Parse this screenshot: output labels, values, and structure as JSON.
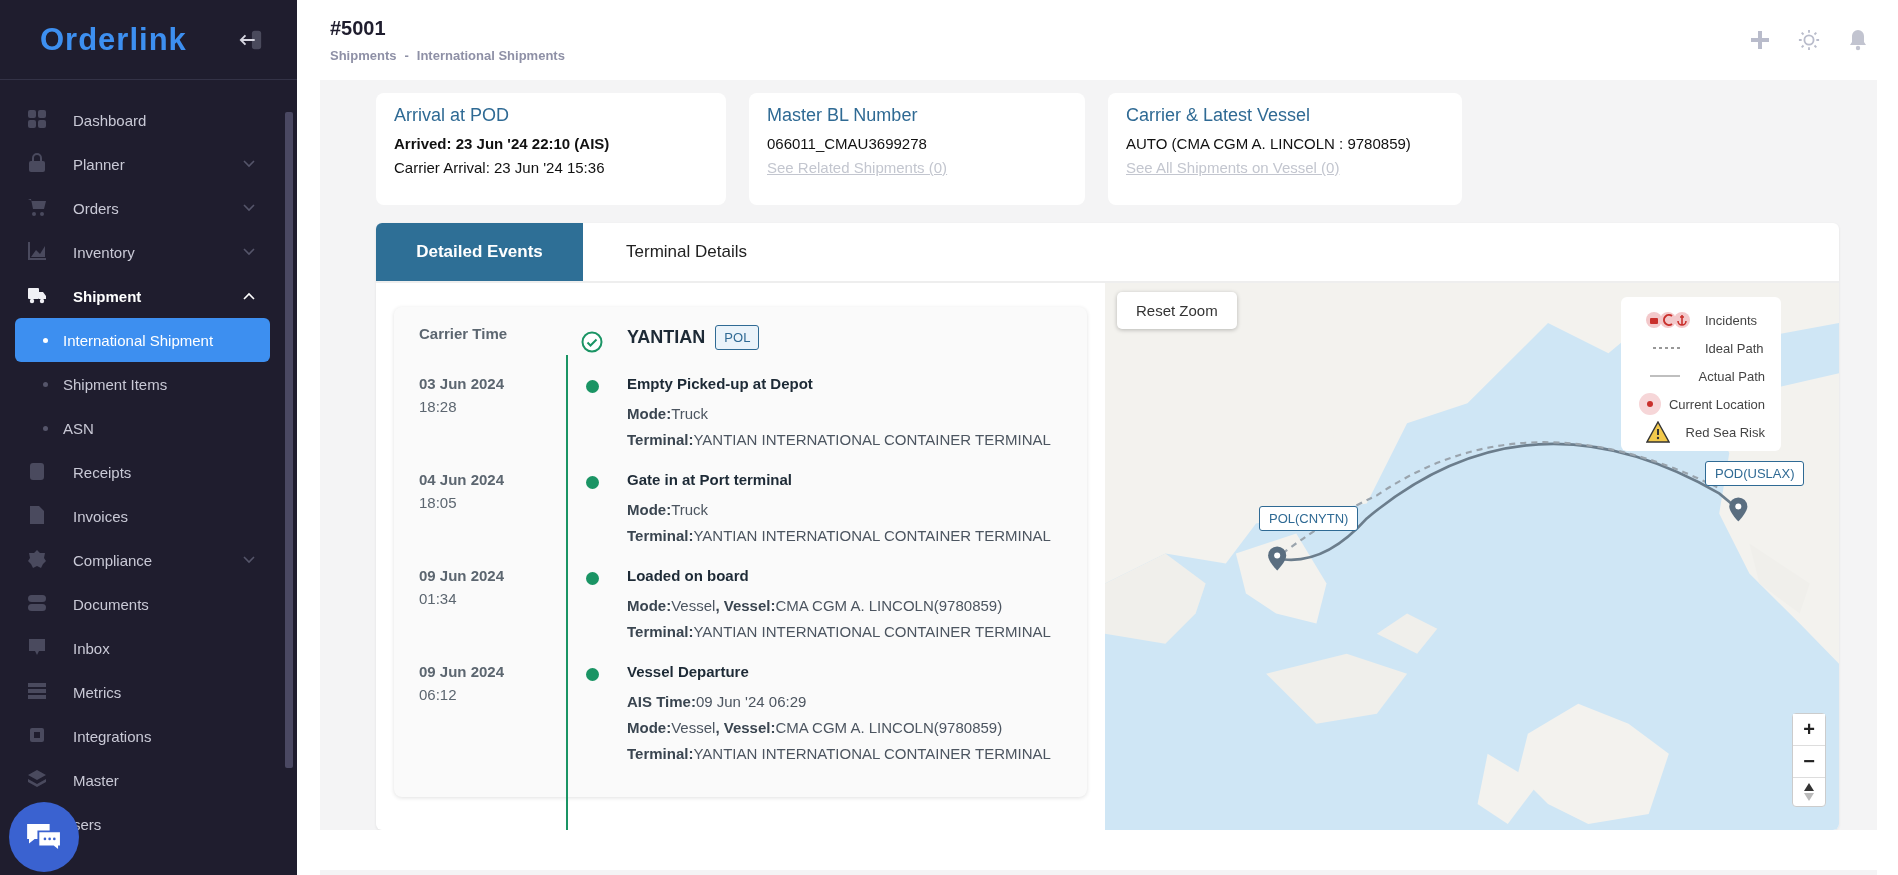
{
  "sidebar": {
    "logo": "Orderlink",
    "items": [
      {
        "label": "Dashboard",
        "kind": "grid"
      },
      {
        "label": "Planner",
        "kind": "bag",
        "expanded": false
      },
      {
        "label": "Orders",
        "kind": "cart",
        "expanded": false
      },
      {
        "label": "Inventory",
        "kind": "chart",
        "expanded": false
      },
      {
        "label": "Shipment",
        "kind": "truck",
        "expanded": true,
        "children": [
          {
            "label": "International Shipment",
            "selected": true
          },
          {
            "label": "Shipment Items",
            "selected": false
          },
          {
            "label": "ASN",
            "selected": false
          }
        ]
      },
      {
        "label": "Receipts",
        "kind": "receipt"
      },
      {
        "label": "Invoices",
        "kind": "doc"
      },
      {
        "label": "Compliance",
        "kind": "badge",
        "expanded": false
      },
      {
        "label": "Documents",
        "kind": "toggle"
      },
      {
        "label": "Inbox",
        "kind": "chat"
      },
      {
        "label": "Metrics",
        "kind": "list"
      },
      {
        "label": "Integrations",
        "kind": "chip"
      },
      {
        "label": "Master",
        "kind": "layers"
      },
      {
        "label": "sers",
        "kind": "none"
      }
    ]
  },
  "header": {
    "title": "#5001",
    "breadcrumb": [
      "Shipments",
      "-",
      "International Shipments"
    ]
  },
  "summary_cards": [
    {
      "title": "Arrival at POD",
      "lines": [
        {
          "text": "Arrived: 23 Jun '24 22:10 (AIS)",
          "kind": "strong"
        },
        {
          "text": "Carrier Arrival: 23 Jun '24 15:36",
          "kind": "plain"
        }
      ]
    },
    {
      "title": "Master BL Number",
      "lines": [
        {
          "text": "066011_CMAU3699278",
          "kind": "plain"
        },
        {
          "text": "See Related Shipments (0)",
          "kind": "link"
        }
      ]
    },
    {
      "title": "Carrier & Latest Vessel",
      "lines": [
        {
          "text": "AUTO (CMA CGM A. LINCOLN : 9780859)",
          "kind": "plain"
        },
        {
          "text": "See All Shipments on Vessel (0)",
          "kind": "link"
        }
      ]
    }
  ],
  "tabs": [
    {
      "label": "Detailed Events",
      "selected": true
    },
    {
      "label": "Terminal Details",
      "selected": false
    }
  ],
  "timeline": {
    "time_heading": "Carrier Time",
    "port": "YANTIAN",
    "port_badge": "POL",
    "events": [
      {
        "date": "03 Jun 2024",
        "time": "18:28",
        "title": "Empty Picked-up at Depot",
        "details": [
          "**Mode:**Truck",
          "**Terminal:**YANTIAN INTERNATIONAL CONTAINER TERMINAL"
        ]
      },
      {
        "date": "04 Jun 2024",
        "time": "18:05",
        "title": "Gate in at Port terminal",
        "details": [
          "**Mode:**Truck",
          "**Terminal:**YANTIAN INTERNATIONAL CONTAINER TERMINAL"
        ]
      },
      {
        "date": "09 Jun 2024",
        "time": "01:34",
        "title": "Loaded on board",
        "details": [
          "**Mode:**Vessel**, Vessel:**CMA CGM A. LINCOLN(9780859)",
          "**Terminal:**YANTIAN INTERNATIONAL CONTAINER TERMINAL"
        ]
      },
      {
        "date": "09 Jun 2024",
        "time": "06:12",
        "title": "Vessel Departure",
        "details": [
          "**AIS Time:**09 Jun '24 06:29",
          "**Mode:**Vessel**, Vessel:**CMA CGM A. LINCOLN(9780859)",
          "**Terminal:**YANTIAN INTERNATIONAL CONTAINER TERMINAL"
        ]
      }
    ]
  },
  "map": {
    "reset_button": "Reset Zoom",
    "pol_label": "POL(CNYTN)",
    "pod_label": "POD(USLAX)",
    "legend": [
      {
        "label": "Incidents",
        "kind": "incidents"
      },
      {
        "label": "Ideal Path",
        "kind": "dashed"
      },
      {
        "label": "Actual Path",
        "kind": "solid"
      },
      {
        "label": "Current Location",
        "kind": "location"
      },
      {
        "label": "Red Sea Risk",
        "kind": "warning"
      }
    ],
    "zoom_in": "+",
    "zoom_out": "−"
  }
}
